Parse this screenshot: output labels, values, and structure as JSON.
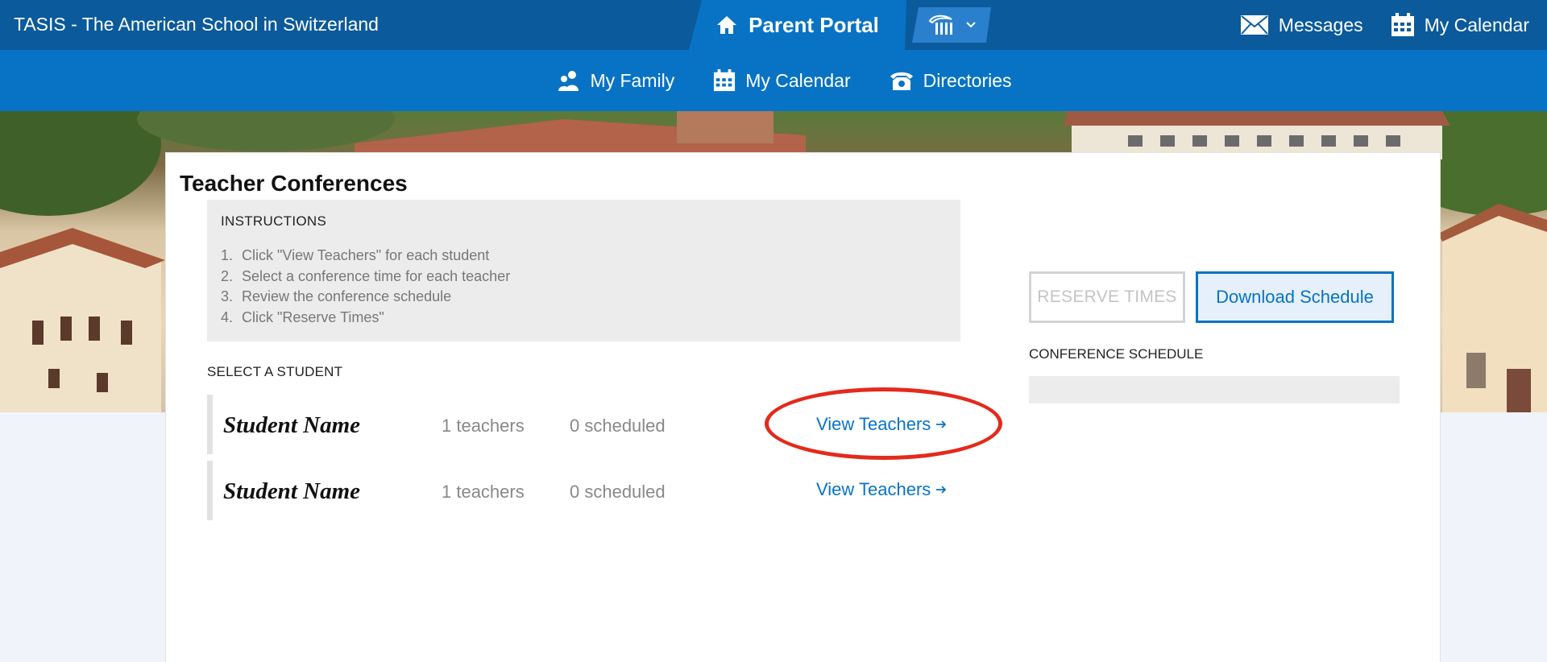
{
  "header": {
    "school_name": "TASIS - The American School in Switzerland",
    "portal_label": "Parent Portal",
    "messages_label": "Messages",
    "calendar_label": "My Calendar"
  },
  "subnav": {
    "items": [
      {
        "label": "My Family",
        "icon": "family-icon"
      },
      {
        "label": "My Calendar",
        "icon": "calendar-icon"
      },
      {
        "label": "Directories",
        "icon": "phone-icon"
      }
    ]
  },
  "page": {
    "title": "Teacher Conferences",
    "instructions": {
      "heading": "INSTRUCTIONS",
      "steps": [
        {
          "num": "1.",
          "text": "Click \"View Teachers\" for each student"
        },
        {
          "num": "2.",
          "text": "Select a conference time for each teacher"
        },
        {
          "num": "3.",
          "text": "Review the conference schedule"
        },
        {
          "num": "4.",
          "text": "Click \"Reserve Times\""
        }
      ]
    },
    "select_student_label": "SELECT A STUDENT",
    "students": [
      {
        "name": "Student Name",
        "teachers": "1 teachers",
        "scheduled": "0 scheduled",
        "link": "View Teachers"
      },
      {
        "name": "Student Name",
        "teachers": "1 teachers",
        "scheduled": "0 scheduled",
        "link": "View Teachers"
      }
    ],
    "reserve_button": "RESERVE TIMES",
    "download_button": "Download Schedule",
    "schedule_label": "CONFERENCE SCHEDULE"
  },
  "colors": {
    "header_dark": "#0b5a9c",
    "header_primary": "#0873c4",
    "link": "#0873c4",
    "highlight": "#e32a1c"
  }
}
